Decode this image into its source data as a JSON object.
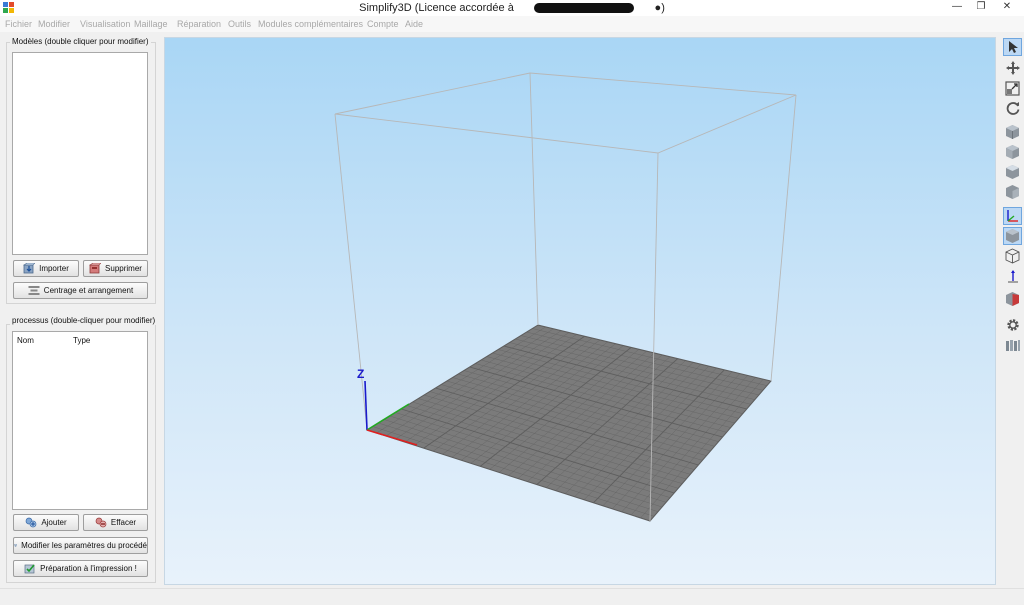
{
  "window": {
    "title": "Simplify3D (Licence accordée à",
    "title_suffix": "●)",
    "minimize": "—",
    "restore": "❐",
    "close": "✕"
  },
  "menu": {
    "items": [
      "Fichier",
      "Modifier",
      "Visualisation",
      "Maillage",
      "Réparation",
      "Outils",
      "Modules complémentaires",
      "Compte",
      "Aide"
    ]
  },
  "models": {
    "title": "Modèles (double cliquer pour modifier)",
    "import_label": "Importer",
    "delete_label": "Supprimer",
    "center_label": "Centrage et arrangement"
  },
  "processes": {
    "title": "processus (double-cliquer pour modifier)",
    "columns": [
      "Nom",
      "Type"
    ],
    "add_label": "Ajouter",
    "remove_label": "Effacer",
    "edit_label": "Modifier les paramètres du procédé",
    "prepare_label": "Préparation à l'impression !"
  },
  "viewport": {
    "axis_z": "Z",
    "colors": {
      "bed": "#7b7b7b",
      "grid": "#5e5e5e",
      "x_axis": "#e02020",
      "y_axis": "#22aa22",
      "z_axis": "#1a1acc"
    }
  },
  "toolbar_icons": [
    "select-arrow-icon",
    "move-icon",
    "scale-icon",
    "rotate-icon",
    "view-cube-icon",
    "view-cube-front-icon",
    "view-cube-top-icon",
    "view-cube-side-icon",
    "axes-icon",
    "solid-cube-icon",
    "wireframe-cube-icon",
    "origin-arrow-icon",
    "cross-section-icon",
    "gear-icon",
    "tools-icon"
  ]
}
